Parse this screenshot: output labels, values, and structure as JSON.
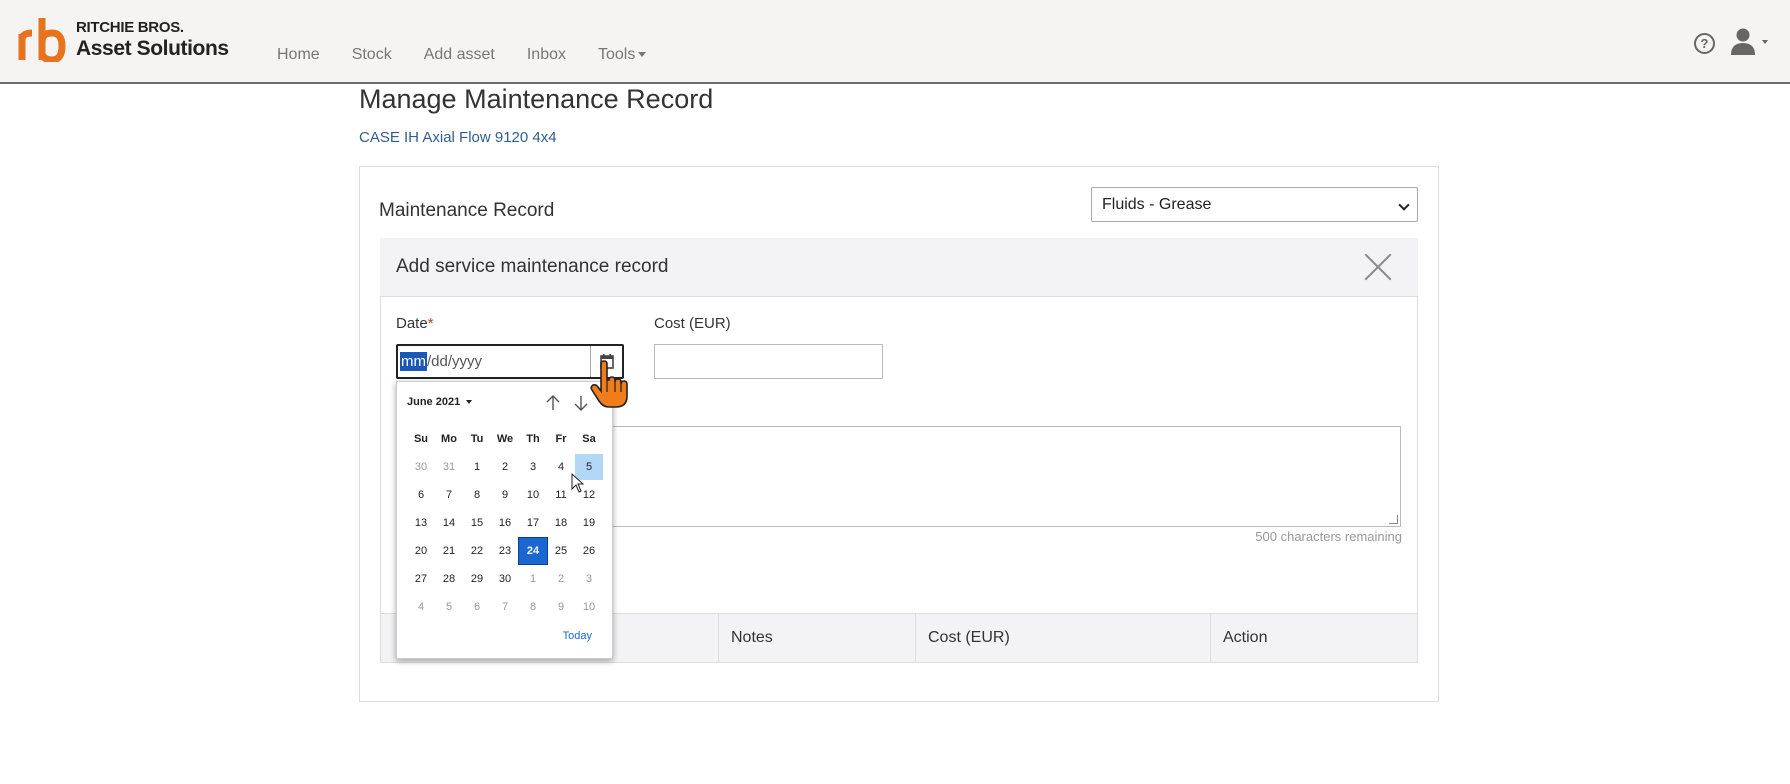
{
  "brand": {
    "line1": "RITCHIE BROS.",
    "line2": "Asset Solutions",
    "accent": "#e8731e"
  },
  "nav": {
    "items": [
      {
        "label": "Home"
      },
      {
        "label": "Stock"
      },
      {
        "label": "Add asset"
      },
      {
        "label": "Inbox"
      },
      {
        "label": "Tools"
      }
    ]
  },
  "header_icons": {
    "help": "question-circle-icon",
    "user": "user-icon"
  },
  "page": {
    "title": "Manage Maintenance Record",
    "asset_name": "CASE IH Axial Flow 9120 4x4"
  },
  "record": {
    "label": "Maintenance Record",
    "selected_type": "Fluids - Grease"
  },
  "form": {
    "title": "Add service maintenance record",
    "date_label": "Date",
    "required_mark": "*",
    "date_value_mm": "mm",
    "date_value_rest": "/dd/yyyy",
    "cost_label": "Cost (EUR)",
    "cost_value": "",
    "notes_value": "",
    "chars_remaining": "500 characters remaining"
  },
  "calendar": {
    "month_label": "June 2021",
    "weekdays": [
      "Su",
      "Mo",
      "Tu",
      "We",
      "Th",
      "Fr",
      "Sa"
    ],
    "weeks": [
      [
        "30",
        "31",
        "1",
        "2",
        "3",
        "4",
        "5"
      ],
      [
        "6",
        "7",
        "8",
        "9",
        "10",
        "11",
        "12"
      ],
      [
        "13",
        "14",
        "15",
        "16",
        "17",
        "18",
        "19"
      ],
      [
        "20",
        "21",
        "22",
        "23",
        "24",
        "25",
        "26"
      ],
      [
        "27",
        "28",
        "29",
        "30",
        "1",
        "2",
        "3"
      ],
      [
        "4",
        "5",
        "6",
        "7",
        "8",
        "9",
        "10"
      ]
    ],
    "selected_day": "24",
    "hovered_day": "5",
    "today_label": "Today"
  },
  "table": {
    "columns": [
      "Notes",
      "Cost (EUR)",
      "Action"
    ]
  }
}
